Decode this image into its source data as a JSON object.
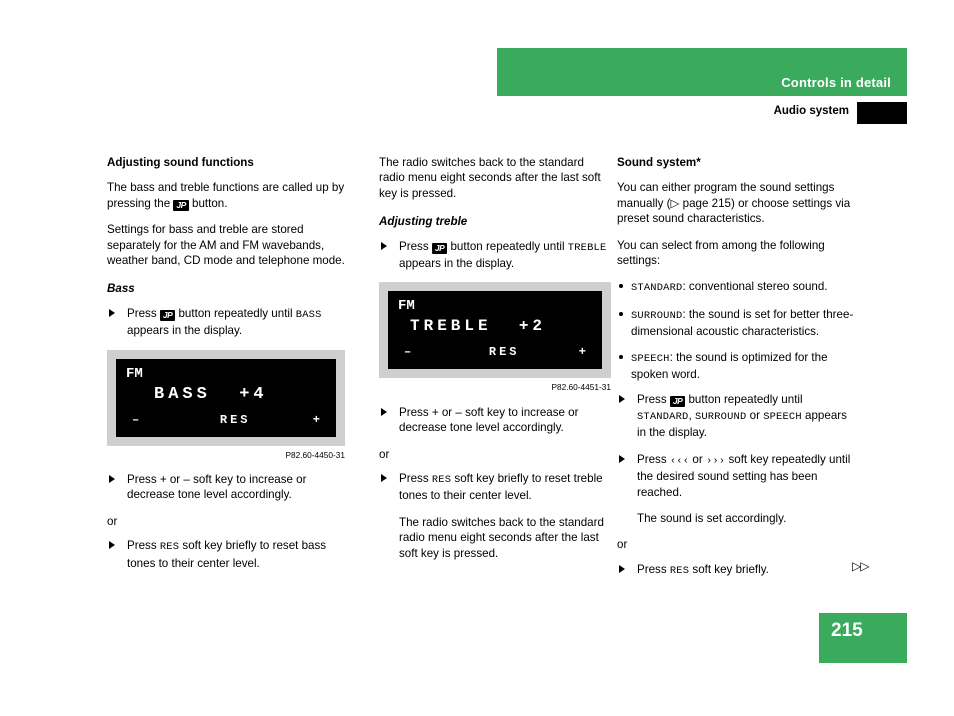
{
  "header": {
    "title": "Controls in detail",
    "subtitle": "Audio system",
    "green": "#3aaa5c"
  },
  "col1": {
    "heading": "Adjusting sound functions",
    "p1_a": "The bass and treble functions are called up by pressing the ",
    "p1_key": "JP",
    "p1_b": " button.",
    "p2": "Settings for bass and treble are stored separately for the AM and FM wavebands, weather band, CD mode and telephone mode.",
    "bass_heading": "Bass",
    "item1_a": "Press ",
    "item1_key": "JP",
    "item1_b": " button repeatedly until ",
    "item1_mono": "BASS",
    "item1_c": " appears in the display.",
    "figure": {
      "fm": "FM",
      "main": "BASS  +4",
      "minus": "–",
      "res": "RES",
      "plus": "+",
      "caption": "P82.60-4450-31"
    },
    "item2_a": "Press ",
    "item2_plus": "+",
    "item2_b": " or ",
    "item2_minus": "–",
    "item2_c": " soft key to increase or decrease tone level accordingly.",
    "or": "or",
    "item3_a": "Press ",
    "item3_mono": "RES",
    "item3_b": " soft key briefly to reset bass tones to their center level."
  },
  "col2": {
    "p1": "The radio switches back to the standard radio menu eight seconds after the last soft key is pressed.",
    "treble_heading": "Adjusting treble",
    "item1_a": "Press ",
    "item1_key": "JP",
    "item1_b": " button repeatedly until ",
    "item1_mono": "TREBLE",
    "item1_c": " appears in the display.",
    "figure": {
      "fm": "FM",
      "main": "TREBLE  +2",
      "minus": "–",
      "res": "RES",
      "plus": "+",
      "caption": "P82.60-4451-31"
    },
    "item2_a": "Press ",
    "item2_plus": "+",
    "item2_b": " or ",
    "item2_minus": "–",
    "item2_c": " soft key to increase or decrease tone level accordingly.",
    "or": "or",
    "item3_a": "Press ",
    "item3_mono": "RES",
    "item3_b": " soft key briefly to reset treble tones to their center level.",
    "p2": "The radio switches back to the standard radio menu eight seconds after the last soft key is pressed."
  },
  "col3": {
    "heading": "Sound system*",
    "p1_a": "You can either program the sound settings manually (",
    "p1_ref": "▷ page 215",
    "p1_b": ") or choose settings via preset sound characteristics.",
    "p2": "You can select from among the following settings:",
    "bullets": [
      {
        "mono": "STANDARD",
        "text": ": conventional stereo sound."
      },
      {
        "mono": "SURROUND",
        "text": ": the sound is set for better three-dimensional acoustic characteristics."
      },
      {
        "mono": "SPEECH",
        "text": ": the sound is optimized for the spoken word."
      }
    ],
    "item1_a": "Press ",
    "item1_key": "JP",
    "item1_b": " button repeatedly until ",
    "item1_m1": "STANDARD",
    "item1_sep1": ", ",
    "item1_m2": "SURROUND",
    "item1_sep2": " or ",
    "item1_m3": "SPEECH",
    "item1_c": " appears in the display.",
    "item2_a": "Press ",
    "item2_m1": "‹‹‹",
    "item2_b": " or ",
    "item2_m2": "›››",
    "item2_c": " soft key repeatedly until the desired sound setting has been reached.",
    "item2_note": "The sound is set accordingly.",
    "or": "or",
    "item3_a": "Press ",
    "item3_mono": "RES",
    "item3_b": " soft key briefly.",
    "continued": "▷▷"
  },
  "footer": {
    "page_number": "215"
  }
}
